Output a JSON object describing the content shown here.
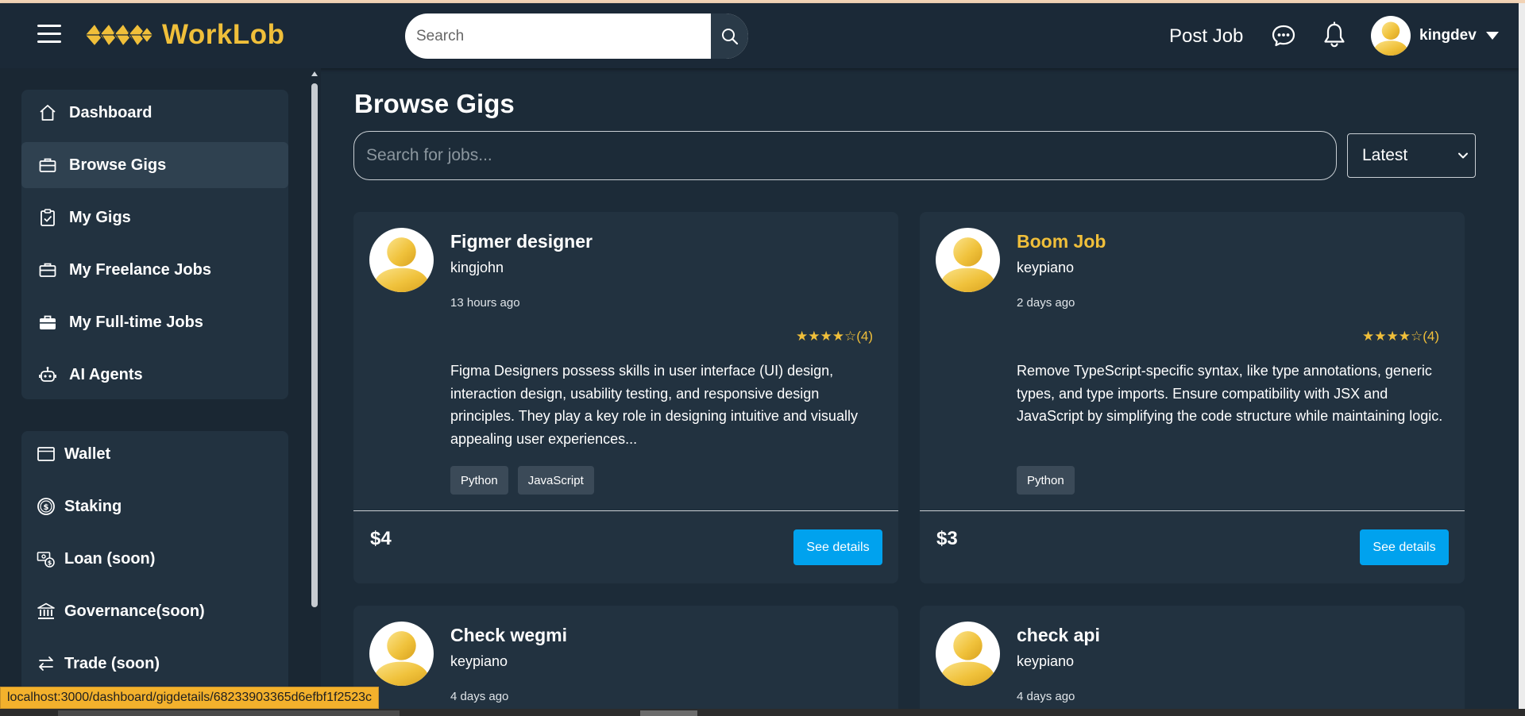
{
  "app": {
    "brand": "WorkLob",
    "brand_color": "#f0bf3a",
    "accent_color": "#00a2ee"
  },
  "header": {
    "search_placeholder": "Search",
    "post_job_label": "Post Job",
    "username": "kingdev",
    "icons": [
      "menu-icon",
      "logo-icon",
      "search-icon",
      "chat-icon",
      "bell-icon",
      "chevron-down-icon"
    ]
  },
  "sidebar": {
    "primary": [
      {
        "label": "Dashboard",
        "icon": "home-icon",
        "active": false
      },
      {
        "label": "Browse Gigs",
        "icon": "briefcase-icon",
        "active": true
      },
      {
        "label": "My Gigs",
        "icon": "clipboard-check-icon",
        "active": false
      },
      {
        "label": "My Freelance Jobs",
        "icon": "briefcase-icon",
        "active": false
      },
      {
        "label": "My Full-time Jobs",
        "icon": "briefcase-fill-icon",
        "active": false
      },
      {
        "label": "AI Agents",
        "icon": "robot-icon",
        "active": false
      }
    ],
    "secondary": [
      {
        "label": "Wallet",
        "icon": "wallet-icon"
      },
      {
        "label": "Staking",
        "icon": "coin-icon"
      },
      {
        "label": "Loan (soon)",
        "icon": "cash-coin-icon"
      },
      {
        "label": "Governance(soon)",
        "icon": "bank-icon"
      },
      {
        "label": "Trade (soon)",
        "icon": "arrow-left-right-icon"
      }
    ]
  },
  "main": {
    "title": "Browse Gigs",
    "search_placeholder": "Search for jobs...",
    "sort_value": "Latest",
    "cards": [
      {
        "title": "Figmer designer",
        "author": "kingjohn",
        "time": "13 hours ago",
        "stars": "★★★★☆",
        "rating_count": "(4)",
        "description": "Figma Designers possess skills in user interface (UI) design, interaction design, usability testing, and responsive design principles. They play a key role in designing intuitive and visually appealing user experiences...",
        "tags": [
          "Python",
          "JavaScript"
        ],
        "price": "$4",
        "button_label": "See details",
        "highlighted": false
      },
      {
        "title": "Boom Job",
        "author": "keypiano",
        "time": "2 days ago",
        "stars": "★★★★☆",
        "rating_count": "(4)",
        "description": "Remove TypeScript-specific syntax, like type annotations, generic types, and type imports. Ensure compatibility with JSX and JavaScript by simplifying the code structure while maintaining logic.",
        "tags": [
          "Python"
        ],
        "price": "$3",
        "button_label": "See details",
        "highlighted": true
      },
      {
        "title": "Check wegmi",
        "author": "keypiano",
        "time": "4 days ago"
      },
      {
        "title": "check api",
        "author": "keypiano",
        "time": "4 days ago"
      }
    ]
  },
  "status_bar": {
    "url": "localhost:3000/dashboard/gigdetails/68233903365d6efbf1f2523c"
  }
}
